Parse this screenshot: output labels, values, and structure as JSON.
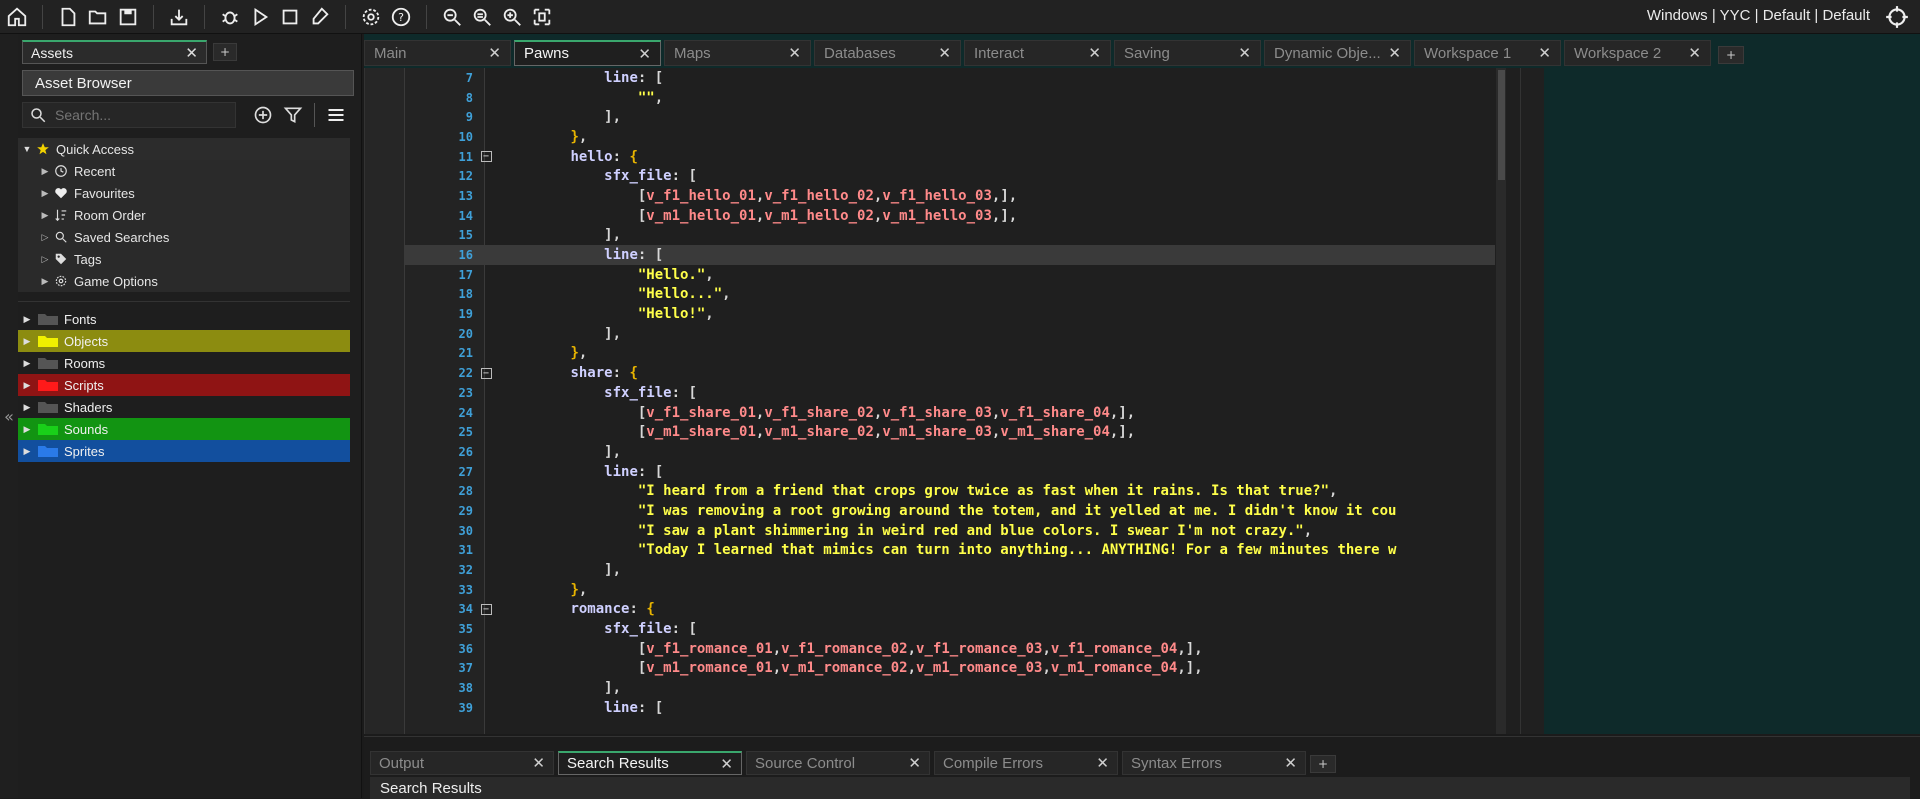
{
  "topbar": {
    "right_text": "Windows | YYC | Default | Default",
    "icons": [
      "home-icon",
      "new-file-icon",
      "open-folder-icon",
      "save-icon",
      "export-icon",
      "debug-icon",
      "run-icon",
      "stop-icon",
      "clean-icon",
      "settings-icon",
      "help-icon",
      "zoom-out-icon",
      "zoom-reset-icon",
      "zoom-in-icon",
      "fit-icon",
      "target-icon"
    ]
  },
  "assets": {
    "tab_label": "Assets",
    "header": "Asset Browser",
    "search_placeholder": "Search...",
    "quick_access": {
      "label": "Quick Access",
      "items": [
        {
          "label": "Recent",
          "icon": "clock-icon"
        },
        {
          "label": "Favourites",
          "icon": "heart-icon"
        },
        {
          "label": "Room Order",
          "icon": "sort-icon"
        },
        {
          "label": "Saved Searches",
          "icon": "search-icon"
        },
        {
          "label": "Tags",
          "icon": "tag-icon"
        },
        {
          "label": "Game Options",
          "icon": "gear-icon"
        }
      ]
    },
    "folders": [
      {
        "label": "Fonts",
        "color": "#1e1e1e",
        "folder_color": "#555555"
      },
      {
        "label": "Objects",
        "color": "#8c8c10",
        "folder_color": "#f0f000"
      },
      {
        "label": "Rooms",
        "color": "#1e1e1e",
        "folder_color": "#555555"
      },
      {
        "label": "Scripts",
        "color": "#8f1414",
        "folder_color": "#ff1a1a"
      },
      {
        "label": "Shaders",
        "color": "#1e1e1e",
        "folder_color": "#555555"
      },
      {
        "label": "Sounds",
        "color": "#129412",
        "folder_color": "#19d019"
      },
      {
        "label": "Sprites",
        "color": "#124f9e",
        "folder_color": "#2a7ae8"
      }
    ]
  },
  "doc_tabs": [
    {
      "label": "Main",
      "active": false
    },
    {
      "label": "Pawns",
      "active": true
    },
    {
      "label": "Maps",
      "active": false
    },
    {
      "label": "Databases",
      "active": false
    },
    {
      "label": "Interact",
      "active": false
    },
    {
      "label": "Saving",
      "active": false
    },
    {
      "label": "Dynamic Obje...",
      "active": false
    },
    {
      "label": "Workspace 1",
      "active": false
    },
    {
      "label": "Workspace 2",
      "active": false
    }
  ],
  "code": {
    "current_line": 16,
    "lines": [
      {
        "n": "7",
        "fold": false,
        "html": "            <span class='k'>line</span><span class='p'>: [</span>"
      },
      {
        "n": "8",
        "fold": false,
        "html": "                <span class='s'>\"\"</span><span class='p'>,</span>"
      },
      {
        "n": "9",
        "fold": false,
        "html": "            <span class='p'>],</span>"
      },
      {
        "n": "10",
        "fold": false,
        "html": "        <span class='b'>}</span><span class='p'>,</span>"
      },
      {
        "n": "11",
        "fold": true,
        "html": "        <span class='k'>hello</span><span class='p'>: </span><span class='b'>{</span>"
      },
      {
        "n": "12",
        "fold": false,
        "html": "            <span class='k'>sfx_file</span><span class='p'>: [</span>"
      },
      {
        "n": "13",
        "fold": false,
        "html": "                <span class='p'>[</span><span class='v'>v_f1_hello_01</span><span class='p'>,</span><span class='v'>v_f1_hello_02</span><span class='p'>,</span><span class='v'>v_f1_hello_03</span><span class='p'>,],</span>"
      },
      {
        "n": "14",
        "fold": false,
        "html": "                <span class='p'>[</span><span class='v'>v_m1_hello_01</span><span class='p'>,</span><span class='v'>v_m1_hello_02</span><span class='p'>,</span><span class='v'>v_m1_hello_03</span><span class='p'>,],</span>"
      },
      {
        "n": "15",
        "fold": false,
        "html": "            <span class='p'>],</span>"
      },
      {
        "n": "16",
        "fold": false,
        "html": "            <span class='k'>line</span><span class='p'>: [</span>"
      },
      {
        "n": "17",
        "fold": false,
        "html": "                <span class='s'>\"Hello.\"</span><span class='p'>,</span>"
      },
      {
        "n": "18",
        "fold": false,
        "html": "                <span class='s'>\"Hello...\"</span><span class='p'>,</span>"
      },
      {
        "n": "19",
        "fold": false,
        "html": "                <span class='s'>\"Hello!\"</span><span class='p'>,</span>"
      },
      {
        "n": "20",
        "fold": false,
        "html": "            <span class='p'>],</span>"
      },
      {
        "n": "21",
        "fold": false,
        "html": "        <span class='b'>}</span><span class='p'>,</span>"
      },
      {
        "n": "22",
        "fold": true,
        "html": "        <span class='k'>share</span><span class='p'>: </span><span class='b'>{</span>"
      },
      {
        "n": "23",
        "fold": false,
        "html": "            <span class='k'>sfx_file</span><span class='p'>: [</span>"
      },
      {
        "n": "24",
        "fold": false,
        "html": "                <span class='p'>[</span><span class='v'>v_f1_share_01</span><span class='p'>,</span><span class='v'>v_f1_share_02</span><span class='p'>,</span><span class='v'>v_f1_share_03</span><span class='p'>,</span><span class='v'>v_f1_share_04</span><span class='p'>,],</span>"
      },
      {
        "n": "25",
        "fold": false,
        "html": "                <span class='p'>[</span><span class='v'>v_m1_share_01</span><span class='p'>,</span><span class='v'>v_m1_share_02</span><span class='p'>,</span><span class='v'>v_m1_share_03</span><span class='p'>,</span><span class='v'>v_m1_share_04</span><span class='p'>,],</span>"
      },
      {
        "n": "26",
        "fold": false,
        "html": "            <span class='p'>],</span>"
      },
      {
        "n": "27",
        "fold": false,
        "html": "            <span class='k'>line</span><span class='p'>: [</span>"
      },
      {
        "n": "28",
        "fold": false,
        "html": "                <span class='s'>\"I heard from a friend that crops grow twice as fast when it rains. Is that true?\"</span><span class='p'>,</span>"
      },
      {
        "n": "29",
        "fold": false,
        "html": "                <span class='s'>\"I was removing a root growing around the totem, and it yelled at me. I didn't know it cou</span>"
      },
      {
        "n": "30",
        "fold": false,
        "html": "                <span class='s'>\"I saw a plant shimmering in weird red and blue colors. I swear I'm not crazy.\"</span><span class='p'>,</span>"
      },
      {
        "n": "31",
        "fold": false,
        "html": "                <span class='s'>\"Today I learned that mimics can turn into anything... ANYTHING! For a few minutes there w</span>"
      },
      {
        "n": "32",
        "fold": false,
        "html": "            <span class='p'>],</span>"
      },
      {
        "n": "33",
        "fold": false,
        "html": "        <span class='b'>}</span><span class='p'>,</span>"
      },
      {
        "n": "34",
        "fold": true,
        "html": "        <span class='k'>romance</span><span class='p'>: </span><span class='b'>{</span>"
      },
      {
        "n": "35",
        "fold": false,
        "html": "            <span class='k'>sfx_file</span><span class='p'>: [</span>"
      },
      {
        "n": "36",
        "fold": false,
        "html": "                <span class='p'>[</span><span class='v'>v_f1_romance_01</span><span class='p'>,</span><span class='v'>v_f1_romance_02</span><span class='p'>,</span><span class='v'>v_f1_romance_03</span><span class='p'>,</span><span class='v'>v_f1_romance_04</span><span class='p'>,],</span>"
      },
      {
        "n": "37",
        "fold": false,
        "html": "                <span class='p'>[</span><span class='v'>v_m1_romance_01</span><span class='p'>,</span><span class='v'>v_m1_romance_02</span><span class='p'>,</span><span class='v'>v_m1_romance_03</span><span class='p'>,</span><span class='v'>v_m1_romance_04</span><span class='p'>,],</span>"
      },
      {
        "n": "38",
        "fold": false,
        "html": "            <span class='p'>],</span>"
      },
      {
        "n": "39",
        "fold": false,
        "html": "            <span class='k'>line</span><span class='p'>: [</span>"
      }
    ]
  },
  "output_tabs": [
    {
      "label": "Output",
      "active": false
    },
    {
      "label": "Search Results",
      "active": true
    },
    {
      "label": "Source Control",
      "active": false
    },
    {
      "label": "Compile Errors",
      "active": false
    },
    {
      "label": "Syntax Errors",
      "active": false
    }
  ],
  "search_results_header": "Search Results",
  "colors": {
    "accent": "#3aa76d",
    "line_numbers": "#3fa0d8",
    "strings": "#ffff4a",
    "variables": "#ff8a8a"
  }
}
